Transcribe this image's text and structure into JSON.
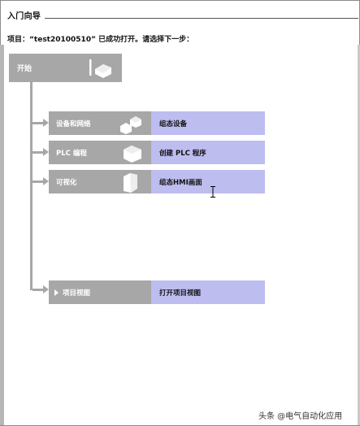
{
  "header": {
    "title": "入门向导"
  },
  "project_message": "项目：“test20100510” 已成功打开。请选择下一步：",
  "start": {
    "label": "开始",
    "icon": "start-icon"
  },
  "steps": [
    {
      "label": "设备和网络",
      "action": "组态设备",
      "icon": "devices-networks-icon"
    },
    {
      "label": "PLC 编程",
      "action": "创建 PLC 程序",
      "icon": "plc-programming-icon"
    },
    {
      "label": "可视化",
      "action": "组态HMI画面",
      "icon": "visualization-icon"
    },
    {
      "label": "项目视图",
      "action": "打开项目视图",
      "icon": "project-view-icon"
    }
  ],
  "watermark": "头条 @电气自动化应用",
  "colors": {
    "gray_block": "#a7a7a7",
    "action_blue": "#bdbdf0"
  }
}
